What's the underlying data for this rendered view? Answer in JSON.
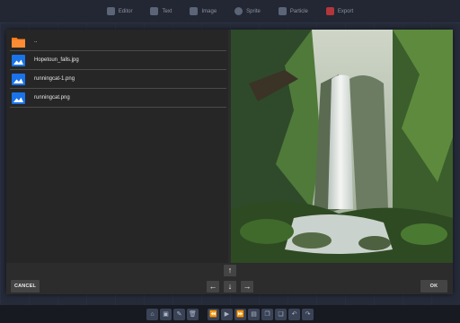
{
  "toolbar": {
    "items": [
      {
        "label": "Editor",
        "icon": "image-icon"
      },
      {
        "label": "Text",
        "icon": "text-icon"
      },
      {
        "label": "Image",
        "icon": "image-icon"
      },
      {
        "label": "Sprite",
        "icon": "sprite-icon"
      },
      {
        "label": "Particle",
        "icon": "particle-icon"
      },
      {
        "label": "Export",
        "icon": "export-icon"
      }
    ]
  },
  "file_browser": {
    "files": [
      {
        "name": "..",
        "type": "folder"
      },
      {
        "name": "Hopetoun_falls.jpg",
        "type": "image"
      },
      {
        "name": "runningcat-1.png",
        "type": "image"
      },
      {
        "name": "runningcat.png",
        "type": "image"
      }
    ],
    "buttons": {
      "cancel": "CANCEL",
      "ok": "OK"
    },
    "nav_glyphs": {
      "up": "↑",
      "left": "←",
      "down": "↓",
      "right": "→"
    }
  },
  "colors": {
    "folder": "#ff7a1a",
    "image_icon": "#1a73e8",
    "export_accent": "#b3363b"
  },
  "bottom_toolbar": {
    "glyphs": [
      "⌂",
      "▣",
      "✎",
      "🗑",
      "⏪",
      "▶",
      "⏩",
      "▤",
      "❐",
      "❏",
      "↶",
      "↷"
    ]
  }
}
